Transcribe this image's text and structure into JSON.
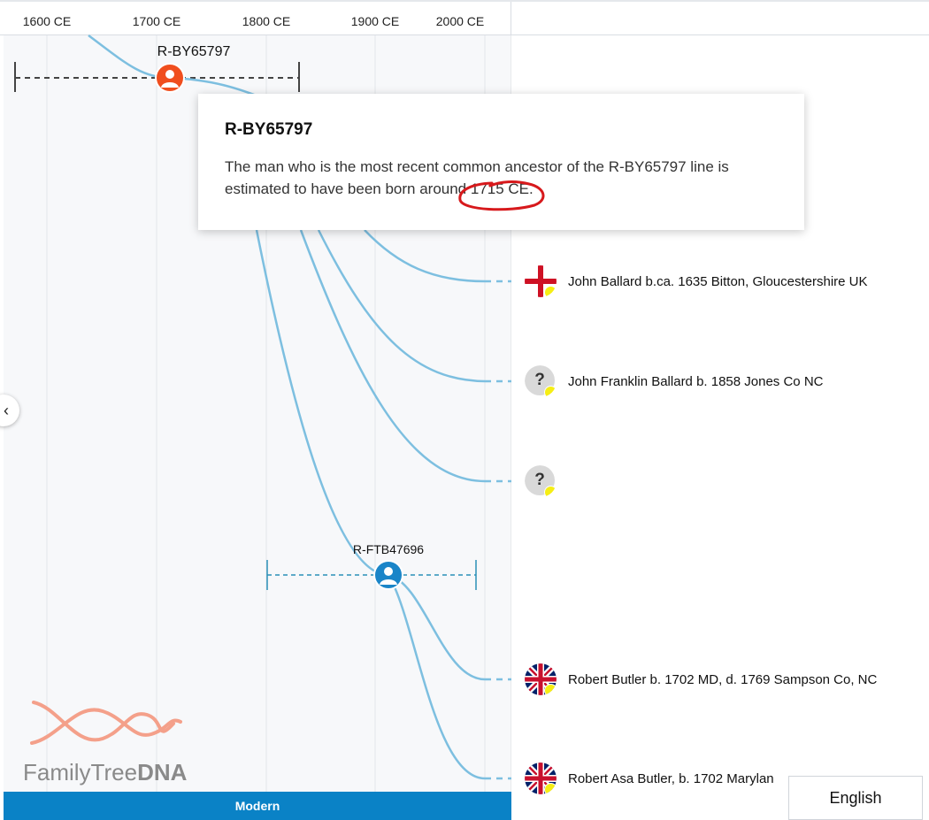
{
  "timeline": {
    "ticks": [
      "1600 CE",
      "1700 CE",
      "1800 CE",
      "1900 CE",
      "2000 CE"
    ],
    "bottom_bar_label": "Modern"
  },
  "nodes": {
    "top": {
      "label": "R-BY65797",
      "color": "#f04e1e"
    },
    "mid": {
      "label": "R-FTB47696",
      "color": "#1a85c8"
    }
  },
  "tooltip": {
    "title": "R-BY65797",
    "body": "The man who is the most recent common ancestor of the R-BY65797 line is estimated to have been born around 1715 CE."
  },
  "leaves": [
    {
      "name": "John Ballard b.ca. 1635 Bitton, Gloucestershire UK",
      "icon": "england-flag-icon"
    },
    {
      "name": "John Franklin Ballard b. 1858 Jones Co NC",
      "icon": "unknown-country-icon"
    },
    {
      "name": "",
      "icon": "unknown-country-icon"
    },
    {
      "name": "Robert Butler b. 1702 MD, d. 1769 Sampson Co, NC",
      "icon": "uk-flag-icon"
    },
    {
      "name": "Robert Asa Butler, b. 1702 Marylan",
      "icon": "uk-flag-icon"
    }
  ],
  "unknown_symbol": "?",
  "branding": {
    "logo_part1": "FamilyTree",
    "logo_part2": "DNA"
  },
  "language_button": "English",
  "side_arrow": "‹",
  "colors": {
    "accent": "#0a82c6",
    "line": "#7dbfe0",
    "highlight": "#d7191c",
    "badge": "#f6ee14"
  }
}
